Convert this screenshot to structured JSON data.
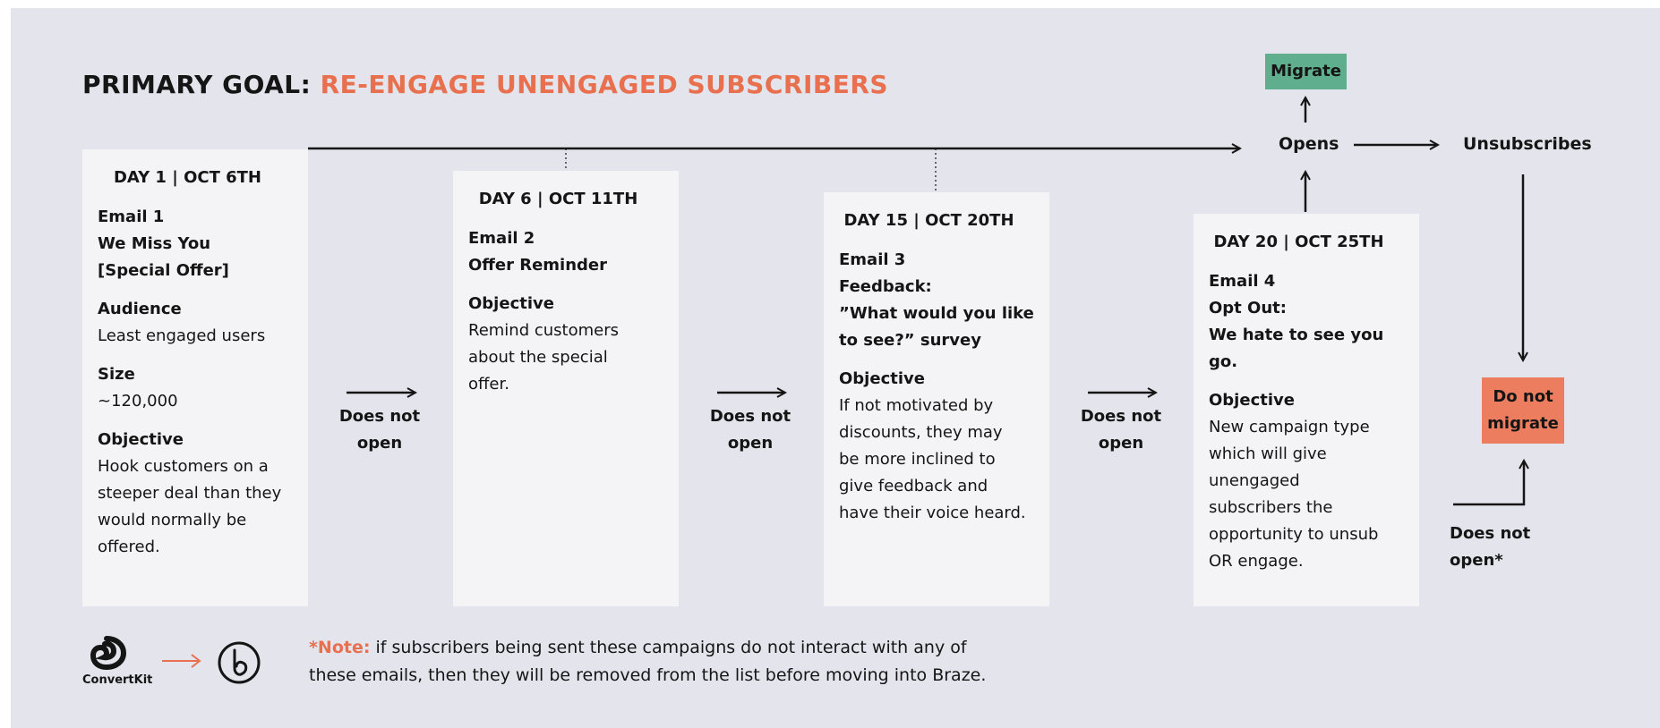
{
  "title": {
    "prefix": "PRIMARY GOAL:",
    "accent": "RE-ENGAGE UNENGAGED SUBSCRIBERS"
  },
  "cards": [
    {
      "day": "DAY 1 | OCT 6TH",
      "lines": [
        {
          "text": "Email 1",
          "bold": true
        },
        {
          "text": "We Miss You",
          "bold": true
        },
        {
          "text": "[Special Offer]",
          "bold": true
        },
        {
          "gap": true
        },
        {
          "text": "Audience",
          "bold": true
        },
        {
          "text": "Least engaged users",
          "bold": false
        },
        {
          "gap": true
        },
        {
          "text": "Size",
          "bold": true
        },
        {
          "text": "~120,000",
          "bold": false
        },
        {
          "gap": true
        },
        {
          "text": "Objective",
          "bold": true
        },
        {
          "text": "Hook customers on a",
          "bold": false
        },
        {
          "text": "steeper deal than they",
          "bold": false
        },
        {
          "text": "would normally be",
          "bold": false
        },
        {
          "text": "offered.",
          "bold": false
        }
      ]
    },
    {
      "day": "DAY 6 | OCT 11TH",
      "lines": [
        {
          "text": "Email 2",
          "bold": true
        },
        {
          "text": "Offer Reminder",
          "bold": true
        },
        {
          "gap": true
        },
        {
          "text": "Objective",
          "bold": true
        },
        {
          "text": "Remind customers",
          "bold": false
        },
        {
          "text": "about the special",
          "bold": false
        },
        {
          "text": "offer.",
          "bold": false
        }
      ]
    },
    {
      "day": "DAY 15 | OCT 20TH",
      "lines": [
        {
          "text": "Email 3",
          "bold": true
        },
        {
          "text": "Feedback:",
          "bold": true
        },
        {
          "text": "”What would you like",
          "bold": true
        },
        {
          "text": "to see?” survey",
          "bold": true
        },
        {
          "gap": true
        },
        {
          "text": "Objective",
          "bold": true
        },
        {
          "text": "If not motivated by",
          "bold": false
        },
        {
          "text": "discounts, they may",
          "bold": false
        },
        {
          "text": "be more inclined to",
          "bold": false
        },
        {
          "text": "give feedback and",
          "bold": false
        },
        {
          "text": "have their voice heard.",
          "bold": false
        }
      ]
    },
    {
      "day": "DAY 20 | OCT 25TH",
      "lines": [
        {
          "text": "Email 4",
          "bold": true
        },
        {
          "text": "Opt Out:",
          "bold": true
        },
        {
          "text": "We hate to see you go.",
          "bold": true
        },
        {
          "gap": true
        },
        {
          "text": "Objective",
          "bold": true
        },
        {
          "text": "New campaign type",
          "bold": false
        },
        {
          "text": "which will give",
          "bold": false
        },
        {
          "text": "unengaged",
          "bold": false
        },
        {
          "text": "subscribers the",
          "bold": false
        },
        {
          "text": "opportunity to unsub",
          "bold": false
        },
        {
          "text": "OR engage.",
          "bold": false
        }
      ]
    }
  ],
  "does_not_open": {
    "line1": "Does not",
    "line2": "open"
  },
  "does_not_open_star": {
    "line1": "Does not",
    "line2": "open*"
  },
  "flow": {
    "opens": "Opens",
    "unsubscribes": "Unsubscribes",
    "migrate": "Migrate",
    "do_not_migrate_1": "Do not",
    "do_not_migrate_2": "migrate"
  },
  "note": {
    "label": "*Note:",
    "line1": " if subscribers being sent these campaigns do not interact with any of",
    "line2": "these emails, then they will be removed from the list before moving into Braze."
  },
  "logos": {
    "convertkit_label": "ConvertKit",
    "convertkit_icon": "convertkit-logo-icon",
    "braze_icon": "braze-logo-icon"
  },
  "colors": {
    "accent": "#e8704f",
    "migrate": "#5fae8d",
    "do_not_migrate": "#ec7d5e",
    "background": "#e4e4ec",
    "card": "#f4f4f6"
  }
}
